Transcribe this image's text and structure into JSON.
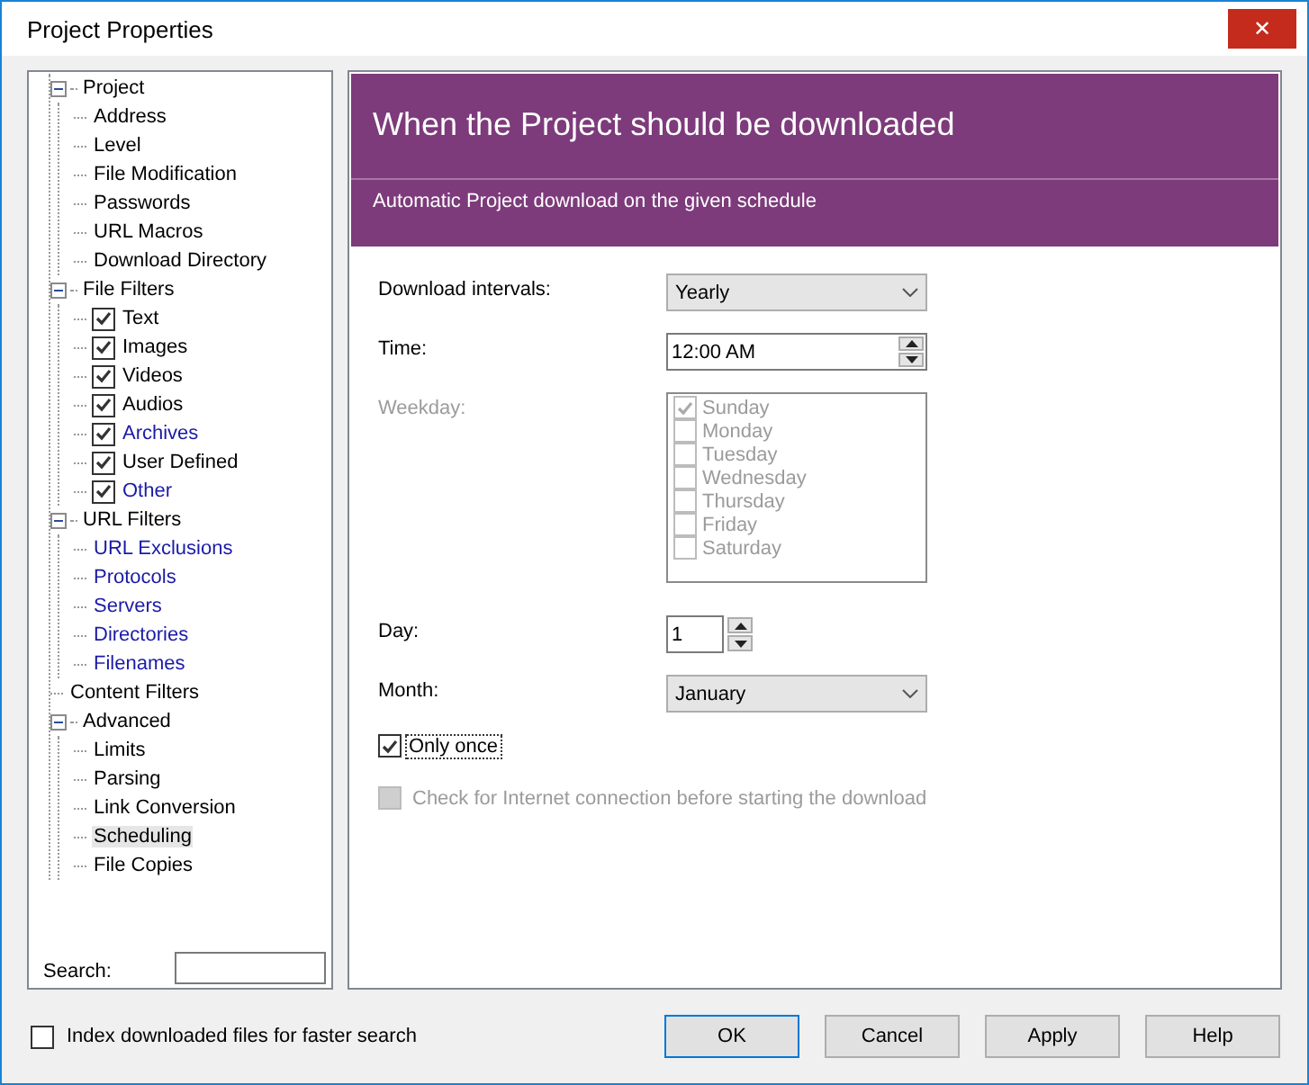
{
  "window": {
    "title": "Project Properties",
    "close_label": "✕"
  },
  "tree": [
    {
      "label": "Project",
      "kind": "node",
      "expanded": true,
      "selected": false,
      "children": [
        {
          "label": "Address",
          "kind": "leaf",
          "selected": false
        },
        {
          "label": "Level",
          "kind": "leaf",
          "selected": false
        },
        {
          "label": "File Modification",
          "kind": "leaf",
          "selected": false
        },
        {
          "label": "Passwords",
          "kind": "leaf",
          "selected": false
        },
        {
          "label": "URL Macros",
          "kind": "leaf",
          "selected": false
        },
        {
          "label": "Download Directory",
          "kind": "leaf",
          "selected": false
        }
      ]
    },
    {
      "label": "File Filters",
      "kind": "node",
      "expanded": true,
      "selected": false,
      "children": [
        {
          "label": "Text",
          "kind": "check",
          "checked": true,
          "linked": false,
          "selected": false
        },
        {
          "label": "Images",
          "kind": "check",
          "checked": true,
          "linked": false,
          "selected": false
        },
        {
          "label": "Videos",
          "kind": "check",
          "checked": true,
          "linked": false,
          "selected": false
        },
        {
          "label": "Audios",
          "kind": "check",
          "checked": true,
          "linked": false,
          "selected": false
        },
        {
          "label": "Archives",
          "kind": "check",
          "checked": true,
          "linked": true,
          "selected": false
        },
        {
          "label": "User Defined",
          "kind": "check",
          "checked": true,
          "linked": false,
          "selected": false
        },
        {
          "label": "Other",
          "kind": "check",
          "checked": true,
          "linked": true,
          "selected": false
        }
      ]
    },
    {
      "label": "URL Filters",
      "kind": "node",
      "expanded": true,
      "selected": false,
      "children": [
        {
          "label": "URL Exclusions",
          "kind": "leaf",
          "linked": true,
          "selected": false
        },
        {
          "label": "Protocols",
          "kind": "leaf",
          "linked": true,
          "selected": false
        },
        {
          "label": "Servers",
          "kind": "leaf",
          "linked": true,
          "selected": false
        },
        {
          "label": "Directories",
          "kind": "leaf",
          "linked": true,
          "selected": false
        },
        {
          "label": "Filenames",
          "kind": "leaf",
          "linked": true,
          "selected": false
        }
      ]
    },
    {
      "label": "Content Filters",
      "kind": "leaf",
      "selected": false
    },
    {
      "label": "Advanced",
      "kind": "node",
      "expanded": true,
      "selected": false,
      "children": [
        {
          "label": "Limits",
          "kind": "leaf",
          "selected": false
        },
        {
          "label": "Parsing",
          "kind": "leaf",
          "selected": false
        },
        {
          "label": "Link Conversion",
          "kind": "leaf",
          "selected": false
        },
        {
          "label": "Scheduling",
          "kind": "leaf",
          "selected": true
        },
        {
          "label": "File Copies",
          "kind": "leaf",
          "selected": false
        }
      ]
    }
  ],
  "search": {
    "label": "Search:"
  },
  "header": {
    "title": "When the Project should be downloaded",
    "subtitle": "Automatic Project download on the given schedule"
  },
  "form": {
    "interval": {
      "label": "Download intervals:",
      "value": "Yearly"
    },
    "time": {
      "label": "Time:",
      "value": "12:00 AM"
    },
    "weekday": {
      "label": "Weekday:",
      "disabled": true,
      "days": [
        {
          "label": "Sunday",
          "checked": true
        },
        {
          "label": "Monday",
          "checked": false
        },
        {
          "label": "Tuesday",
          "checked": false
        },
        {
          "label": "Wednesday",
          "checked": false
        },
        {
          "label": "Thursday",
          "checked": false
        },
        {
          "label": "Friday",
          "checked": false
        },
        {
          "label": "Saturday",
          "checked": false
        }
      ]
    },
    "day": {
      "label": "Day:",
      "value": "1"
    },
    "month": {
      "label": "Month:",
      "value": "January"
    },
    "only_once": {
      "label": "Only once",
      "checked": true,
      "disabled": false
    },
    "check_internet": {
      "label": "Check for Internet connection before starting the download",
      "checked": false,
      "disabled": true
    }
  },
  "index_option": {
    "label": "Index downloaded files for faster search",
    "checked": false
  },
  "buttons": [
    {
      "label": "OK",
      "default": true
    },
    {
      "label": "Cancel",
      "default": false
    },
    {
      "label": "Apply",
      "default": false
    },
    {
      "label": "Help",
      "default": false
    }
  ]
}
